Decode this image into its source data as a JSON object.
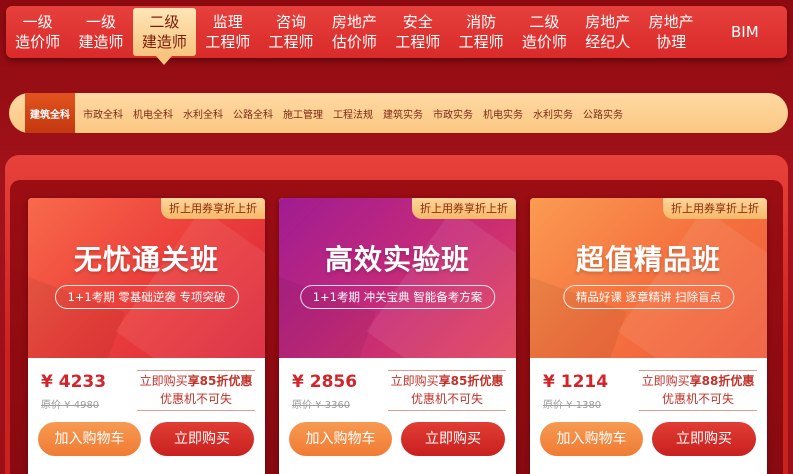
{
  "topnav": {
    "items": [
      {
        "line1": "一级",
        "line2": "造价师"
      },
      {
        "line1": "一级",
        "line2": "建造师"
      },
      {
        "line1": "二级",
        "line2": "建造师"
      },
      {
        "line1": "监理",
        "line2": "工程师"
      },
      {
        "line1": "咨询",
        "line2": "工程师"
      },
      {
        "line1": "房地产",
        "line2": "估价师"
      },
      {
        "line1": "安全",
        "line2": "工程师"
      },
      {
        "line1": "消防",
        "line2": "工程师"
      },
      {
        "line1": "二级",
        "line2": "造价师"
      },
      {
        "line1": "房地产",
        "line2": "经纪人"
      },
      {
        "line1": "房地产",
        "line2": "协理"
      }
    ],
    "bim": "BIM",
    "active_index": 2
  },
  "subnav": {
    "items": [
      "建筑全科",
      "市政全科",
      "机电全科",
      "水利全科",
      "公路全科",
      "施工管理",
      "工程法规",
      "建筑实务",
      "市政实务",
      "机电实务",
      "水利实务",
      "公路实务"
    ],
    "active_index": 0
  },
  "cards": [
    {
      "badge": "折上用券享折上折",
      "title": "无忧通关班",
      "tags": "1+1考期 零基础逆袭 专项突破",
      "price": "¥ 4233",
      "price_old": "原价 ¥ 4980",
      "promo_prefix": "立即购买",
      "promo_discount": "享85折优惠",
      "promo_note": "优惠机不可失",
      "cart_label": "加入购物车",
      "buy_label": "立即购买"
    },
    {
      "badge": "折上用券享折上折",
      "title": "高效实验班",
      "tags": "1+1考期 冲关宝典 智能备考方案",
      "price": "¥ 2856",
      "price_old": "原价 ¥ 3360",
      "promo_prefix": "立即购买",
      "promo_discount": "享85折优惠",
      "promo_note": "优惠机不可失",
      "cart_label": "加入购物车",
      "buy_label": "立即购买"
    },
    {
      "badge": "折上用券享折上折",
      "title": "超值精品班",
      "tags": "精品好课 逐章精讲 扫除盲点",
      "price": "¥ 1214",
      "price_old": "原价 ¥ 1380",
      "promo_prefix": "立即购买",
      "promo_discount": "享88折优惠",
      "promo_note": "优惠机不可失",
      "cart_label": "加入购物车",
      "buy_label": "立即购买"
    }
  ],
  "colors": {
    "brand_red": "#d92a2a",
    "gold": "#f7c47d",
    "price_red": "#d4242a",
    "cart_orange": "#f07b34"
  }
}
